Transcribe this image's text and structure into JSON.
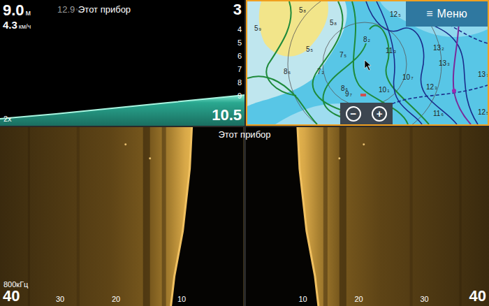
{
  "sonar": {
    "depth": "9.0",
    "depth_unit": "м",
    "speed": "4.3",
    "speed_unit": "км/ч",
    "temp": "12.9",
    "temp_unit": "°c",
    "source": "Этот прибор",
    "range_top": "3",
    "ticks": [
      "4",
      "5",
      "6",
      "7",
      "8",
      "9"
    ],
    "range_bottom": "10.5",
    "zoom": "2x"
  },
  "map": {
    "selected": true,
    "menu": {
      "icon": "≡",
      "label": "Меню"
    },
    "zoom_out": "−",
    "zoom_in": "+",
    "depths": [
      {
        "int": "5",
        "dec": "8"
      },
      {
        "int": "5",
        "dec": "9"
      },
      {
        "int": "5",
        "dec": "8"
      },
      {
        "int": "5",
        "dec": "5"
      },
      {
        "int": "8",
        "dec": "2"
      },
      {
        "int": "7",
        "dec": "5"
      },
      {
        "int": "8",
        "dec": "6"
      },
      {
        "int": "7",
        "dec": "2"
      },
      {
        "int": "12",
        "dec": "5"
      },
      {
        "int": "13",
        "dec": "2"
      },
      {
        "int": "11",
        "dec": "3"
      },
      {
        "int": "10",
        "dec": "7"
      },
      {
        "int": "12",
        "dec": "3"
      },
      {
        "int": "13",
        "dec": "3"
      },
      {
        "int": "13",
        "dec": "7"
      },
      {
        "int": "9",
        "dec": "7"
      },
      {
        "int": "10",
        "dec": "1"
      },
      {
        "int": "9",
        "dec": "7"
      },
      {
        "int": "11",
        "dec": "6"
      },
      {
        "int": "12",
        "dec": "5"
      },
      {
        "int": "8",
        "dec": "6"
      }
    ]
  },
  "side_scan": {
    "title": "Этот прибор",
    "frequency": "800кГц",
    "range_left": "40",
    "range_right": "40",
    "left_ticks": [
      "30",
      "20",
      "10"
    ],
    "right_ticks": [
      "10",
      "20",
      "30"
    ]
  }
}
